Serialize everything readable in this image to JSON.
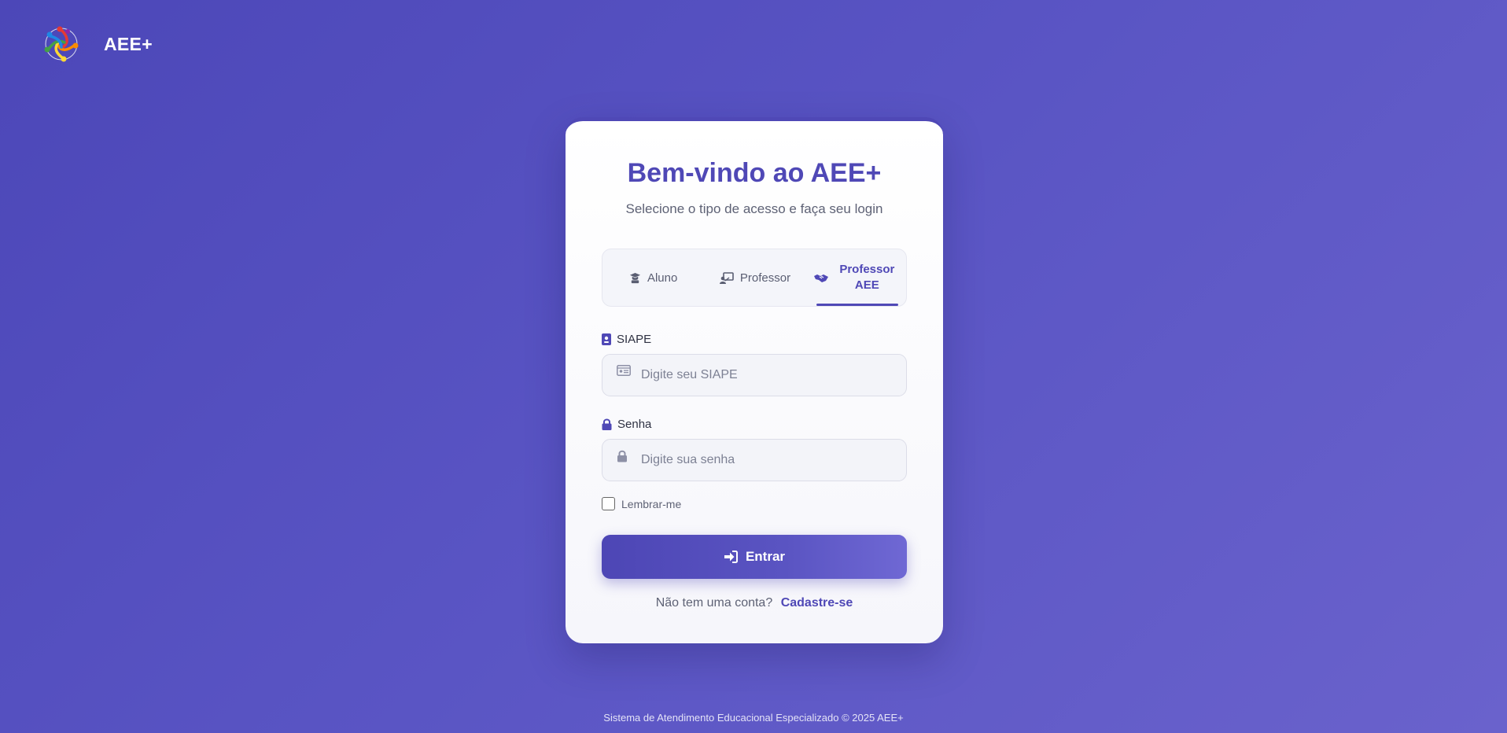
{
  "header": {
    "brand": "AEE+"
  },
  "card": {
    "title": "Bem-vindo ao AEE+",
    "subtitle": "Selecione o tipo de acesso e faça seu login",
    "tabs": [
      {
        "label": "Aluno",
        "icon": "graduate-icon",
        "active": false
      },
      {
        "label": "Professor",
        "icon": "chalkboard-teacher-icon",
        "active": false
      },
      {
        "label": "Professor AEE",
        "icon": "handshake-icon",
        "active": true
      }
    ],
    "siape": {
      "label": "SIAPE",
      "placeholder": "Digite seu SIAPE",
      "value": ""
    },
    "senha": {
      "label": "Senha",
      "placeholder": "Digite sua senha",
      "value": ""
    },
    "remember_label": "Lembrar-me",
    "submit_label": "Entrar",
    "signup_prompt": "Não tem uma conta?",
    "signup_link": "Cadastre-se"
  },
  "footer": {
    "text": "Sistema de Atendimento Educacional Especializado © 2025 AEE+"
  },
  "colors": {
    "accent": "#4f48b6",
    "background": "#5a55c4"
  }
}
